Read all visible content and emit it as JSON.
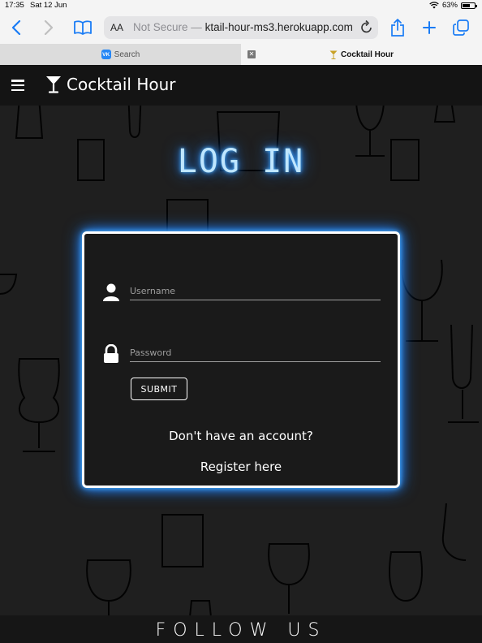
{
  "status_bar": {
    "time": "17:35",
    "date": "Sat 12 Jun",
    "battery": "63%",
    "battery_level": 0.63
  },
  "browser": {
    "text_size_label": "AA",
    "not_secure_label": "Not Secure —",
    "domain": "ktail-hour-ms3.herokuapp.com",
    "tabs": [
      {
        "label": "Search",
        "badge": "VK"
      },
      {
        "label": "Cocktail Hour"
      }
    ]
  },
  "site": {
    "brand": "Cocktail Hour",
    "page_title": "LOG IN",
    "form": {
      "username_placeholder": "Username",
      "password_placeholder": "Password",
      "submit_label": "SUBMIT",
      "no_account_text": "Don't have an account?",
      "register_link": "Register here"
    },
    "footer_title": "FOLLOW US"
  },
  "colors": {
    "glow": "#2a8cff",
    "accent_browser": "#1a7cf5"
  }
}
